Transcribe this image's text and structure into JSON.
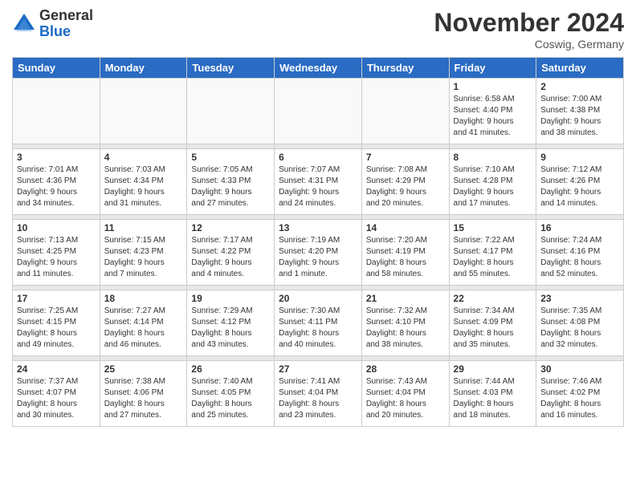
{
  "logo": {
    "general": "General",
    "blue": "Blue"
  },
  "header": {
    "month": "November 2024",
    "location": "Coswig, Germany"
  },
  "days_of_week": [
    "Sunday",
    "Monday",
    "Tuesday",
    "Wednesday",
    "Thursday",
    "Friday",
    "Saturday"
  ],
  "weeks": [
    [
      {
        "day": "",
        "info": ""
      },
      {
        "day": "",
        "info": ""
      },
      {
        "day": "",
        "info": ""
      },
      {
        "day": "",
        "info": ""
      },
      {
        "day": "",
        "info": ""
      },
      {
        "day": "1",
        "info": "Sunrise: 6:58 AM\nSunset: 4:40 PM\nDaylight: 9 hours\nand 41 minutes."
      },
      {
        "day": "2",
        "info": "Sunrise: 7:00 AM\nSunset: 4:38 PM\nDaylight: 9 hours\nand 38 minutes."
      }
    ],
    [
      {
        "day": "3",
        "info": "Sunrise: 7:01 AM\nSunset: 4:36 PM\nDaylight: 9 hours\nand 34 minutes."
      },
      {
        "day": "4",
        "info": "Sunrise: 7:03 AM\nSunset: 4:34 PM\nDaylight: 9 hours\nand 31 minutes."
      },
      {
        "day": "5",
        "info": "Sunrise: 7:05 AM\nSunset: 4:33 PM\nDaylight: 9 hours\nand 27 minutes."
      },
      {
        "day": "6",
        "info": "Sunrise: 7:07 AM\nSunset: 4:31 PM\nDaylight: 9 hours\nand 24 minutes."
      },
      {
        "day": "7",
        "info": "Sunrise: 7:08 AM\nSunset: 4:29 PM\nDaylight: 9 hours\nand 20 minutes."
      },
      {
        "day": "8",
        "info": "Sunrise: 7:10 AM\nSunset: 4:28 PM\nDaylight: 9 hours\nand 17 minutes."
      },
      {
        "day": "9",
        "info": "Sunrise: 7:12 AM\nSunset: 4:26 PM\nDaylight: 9 hours\nand 14 minutes."
      }
    ],
    [
      {
        "day": "10",
        "info": "Sunrise: 7:13 AM\nSunset: 4:25 PM\nDaylight: 9 hours\nand 11 minutes."
      },
      {
        "day": "11",
        "info": "Sunrise: 7:15 AM\nSunset: 4:23 PM\nDaylight: 9 hours\nand 7 minutes."
      },
      {
        "day": "12",
        "info": "Sunrise: 7:17 AM\nSunset: 4:22 PM\nDaylight: 9 hours\nand 4 minutes."
      },
      {
        "day": "13",
        "info": "Sunrise: 7:19 AM\nSunset: 4:20 PM\nDaylight: 9 hours\nand 1 minute."
      },
      {
        "day": "14",
        "info": "Sunrise: 7:20 AM\nSunset: 4:19 PM\nDaylight: 8 hours\nand 58 minutes."
      },
      {
        "day": "15",
        "info": "Sunrise: 7:22 AM\nSunset: 4:17 PM\nDaylight: 8 hours\nand 55 minutes."
      },
      {
        "day": "16",
        "info": "Sunrise: 7:24 AM\nSunset: 4:16 PM\nDaylight: 8 hours\nand 52 minutes."
      }
    ],
    [
      {
        "day": "17",
        "info": "Sunrise: 7:25 AM\nSunset: 4:15 PM\nDaylight: 8 hours\nand 49 minutes."
      },
      {
        "day": "18",
        "info": "Sunrise: 7:27 AM\nSunset: 4:14 PM\nDaylight: 8 hours\nand 46 minutes."
      },
      {
        "day": "19",
        "info": "Sunrise: 7:29 AM\nSunset: 4:12 PM\nDaylight: 8 hours\nand 43 minutes."
      },
      {
        "day": "20",
        "info": "Sunrise: 7:30 AM\nSunset: 4:11 PM\nDaylight: 8 hours\nand 40 minutes."
      },
      {
        "day": "21",
        "info": "Sunrise: 7:32 AM\nSunset: 4:10 PM\nDaylight: 8 hours\nand 38 minutes."
      },
      {
        "day": "22",
        "info": "Sunrise: 7:34 AM\nSunset: 4:09 PM\nDaylight: 8 hours\nand 35 minutes."
      },
      {
        "day": "23",
        "info": "Sunrise: 7:35 AM\nSunset: 4:08 PM\nDaylight: 8 hours\nand 32 minutes."
      }
    ],
    [
      {
        "day": "24",
        "info": "Sunrise: 7:37 AM\nSunset: 4:07 PM\nDaylight: 8 hours\nand 30 minutes."
      },
      {
        "day": "25",
        "info": "Sunrise: 7:38 AM\nSunset: 4:06 PM\nDaylight: 8 hours\nand 27 minutes."
      },
      {
        "day": "26",
        "info": "Sunrise: 7:40 AM\nSunset: 4:05 PM\nDaylight: 8 hours\nand 25 minutes."
      },
      {
        "day": "27",
        "info": "Sunrise: 7:41 AM\nSunset: 4:04 PM\nDaylight: 8 hours\nand 23 minutes."
      },
      {
        "day": "28",
        "info": "Sunrise: 7:43 AM\nSunset: 4:04 PM\nDaylight: 8 hours\nand 20 minutes."
      },
      {
        "day": "29",
        "info": "Sunrise: 7:44 AM\nSunset: 4:03 PM\nDaylight: 8 hours\nand 18 minutes."
      },
      {
        "day": "30",
        "info": "Sunrise: 7:46 AM\nSunset: 4:02 PM\nDaylight: 8 hours\nand 16 minutes."
      }
    ]
  ]
}
